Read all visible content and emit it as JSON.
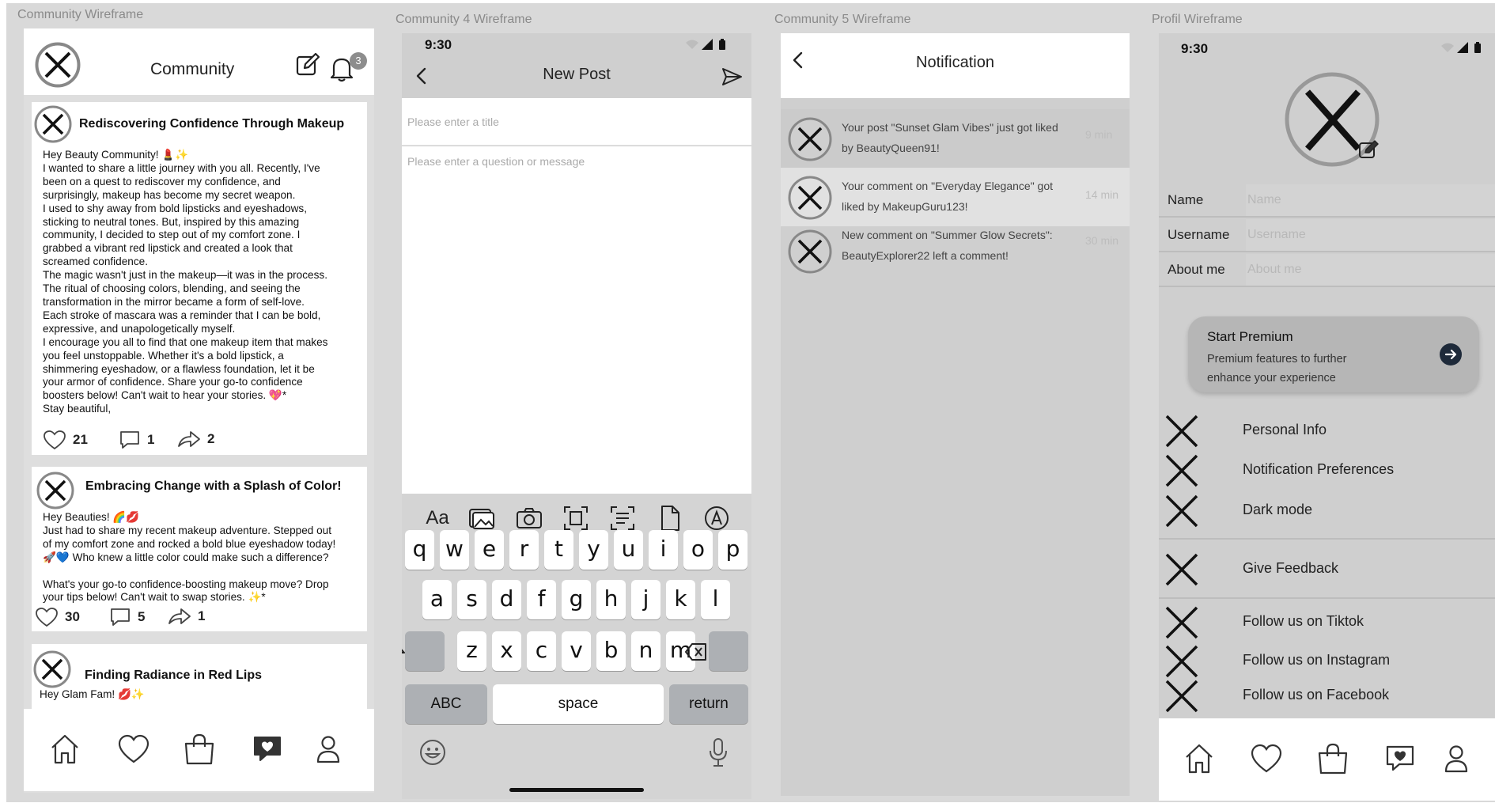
{
  "frames": {
    "community": "Community Wireframe",
    "newpost": "Community 4 Wireframe",
    "notification": "Community 5 Wireframe",
    "profile": "Profil Wireframe"
  },
  "community": {
    "title": "Community",
    "badge": "3",
    "posts": [
      {
        "title": "Rediscovering Confidence Through Makeup",
        "lines": [
          "Hey Beauty Community! 💄✨",
          "I wanted to share a little journey with you all. Recently, I've",
          "been on a quest to rediscover my confidence, and",
          " surprisingly, makeup has become my secret weapon.",
          "I used to shy away from bold lipsticks and eyeshadows,",
          "sticking to neutral tones. But, inspired by this amazing",
          "community, I decided to step out of my comfort zone. I",
          "grabbed a vibrant red lipstick and created a look that",
          "screamed confidence.",
          "The magic wasn't just in the makeup—it was in the process.",
          "The ritual of choosing colors, blending, and seeing the",
          "transformation in the mirror became a form of self-love.",
          "Each stroke of mascara was a reminder that I can be bold,",
          "expressive, and unapologetically myself.",
          "I encourage you all to find that one makeup item that makes",
          "you feel unstoppable. Whether it's a bold lipstick, a",
          "shimmering eyeshadow, or a flawless foundation, let it be",
          "your armor of confidence. Share your go-to confidence",
          "boosters below! Can't wait to hear your stories. 💖*",
          "Stay beautiful,"
        ],
        "likes": "21",
        "comments": "1",
        "shares": "2"
      },
      {
        "title": "Embracing Change with a Splash of Color!",
        "lines": [
          "Hey Beauties! 🌈💋",
          "Just had to share my recent makeup adventure. Stepped out",
          "of my comfort zone and rocked a bold blue eyeshadow today!",
          "🚀💙 Who knew a little color could make such a difference?",
          "",
          "What's your go-to confidence-boosting makeup move? Drop",
          "your tips below! Can't wait to swap stories. ✨*"
        ],
        "likes": "30",
        "comments": "5",
        "shares": "1"
      },
      {
        "title": "Finding Radiance in Red Lips",
        "lines": [
          "Hey Glam Fam! 💋✨"
        ]
      }
    ]
  },
  "newpost": {
    "time": "9:30",
    "title": "New Post",
    "title_placeholder": "Please enter a title",
    "message_placeholder": "Please enter a question or message",
    "tool_aa": "Aa",
    "row1": [
      "q",
      "w",
      "e",
      "r",
      "t",
      "y",
      "u",
      "i",
      "o",
      "p"
    ],
    "row2": [
      "a",
      "s",
      "d",
      "f",
      "g",
      "h",
      "j",
      "k",
      "l"
    ],
    "row3": [
      "z",
      "x",
      "c",
      "v",
      "b",
      "n",
      "m"
    ],
    "abc": "ABC",
    "space": "space",
    "return": "return"
  },
  "notification": {
    "title": "Notification",
    "items": [
      {
        "line1": "Your post \"Sunset Glam Vibes\" just got liked",
        "line2": "by BeautyQueen91!",
        "time": "9 min"
      },
      {
        "line1": "Your comment on \"Everyday Elegance\" got",
        "line2": "liked by MakeupGuru123!",
        "time": "14 min"
      },
      {
        "line1": "New comment on \"Summer Glow Secrets\":",
        "line2": "BeautyExplorer22 left a comment!",
        "time": "30 min"
      }
    ]
  },
  "profile": {
    "time": "9:30",
    "fields": [
      {
        "label": "Name",
        "placeholder": "Name"
      },
      {
        "label": "Username",
        "placeholder": "Username"
      },
      {
        "label": "About me",
        "placeholder": "About me"
      }
    ],
    "premium": {
      "title": "Start Premium",
      "line1": "Premium features to further",
      "line2": " enhance your experience"
    },
    "menu": [
      "Personal Info",
      "Notification Preferences",
      "Dark mode",
      "Give Feedback",
      "Follow us on Tiktok",
      "Follow us on Instagram",
      "Follow us on Facebook"
    ]
  }
}
